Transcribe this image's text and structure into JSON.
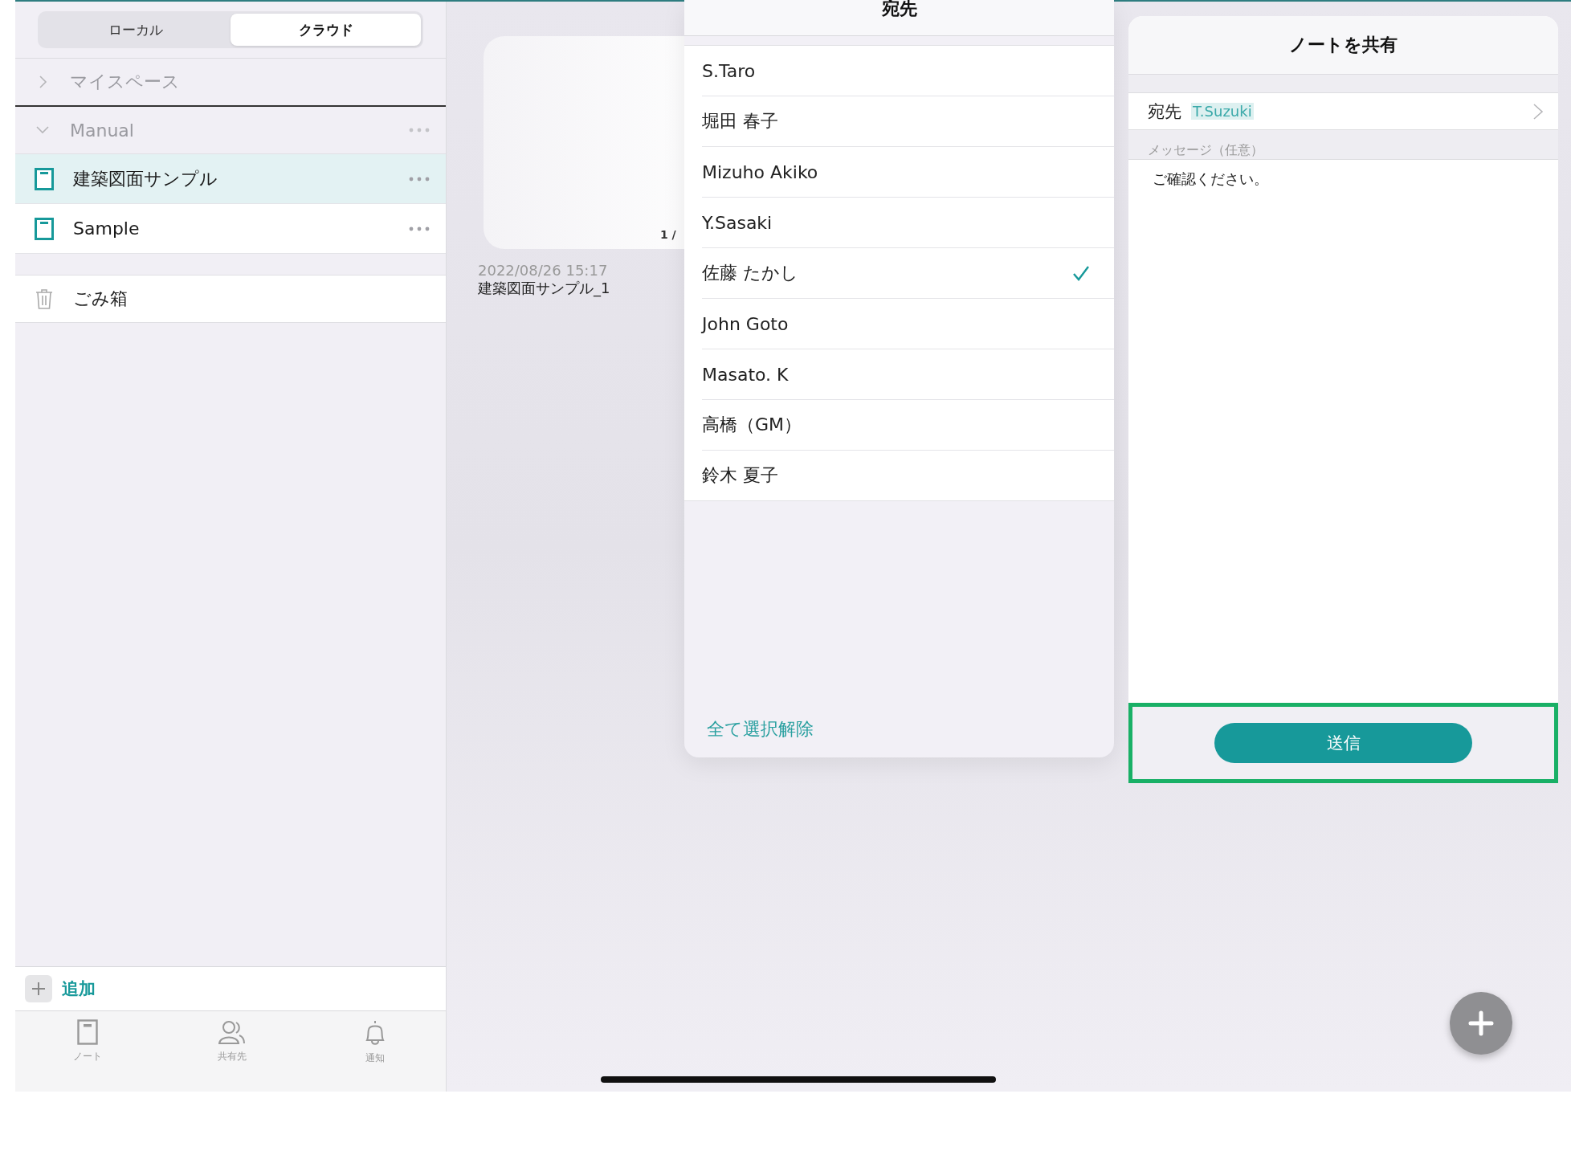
{
  "segmented": [
    {
      "label": "ローカル",
      "selected": false
    },
    {
      "label": "クラウド",
      "selected": true
    }
  ],
  "tree": [
    {
      "label": "マイスペース",
      "expanded": false
    },
    {
      "label": "Manual",
      "expanded": true,
      "children": [
        {
          "label": "建築図面サンプル",
          "selected": true
        },
        {
          "label": "Sample",
          "selected": false
        }
      ]
    }
  ],
  "trash": {
    "label": "ごみ箱"
  },
  "add_button": {
    "label": "追加"
  },
  "tab_bar": [
    {
      "kind": "note",
      "label": "ノート"
    },
    {
      "kind": "people",
      "label": "共有先"
    },
    {
      "kind": "bell",
      "label": "通知"
    }
  ],
  "note_card": {
    "page": "1 /",
    "date": "2022/08/26 15:17",
    "title": "建築図面サンプル_1"
  },
  "recipients": {
    "title": "宛先",
    "items": [
      {
        "name": "S.Taro",
        "selected": false
      },
      {
        "name": "堀田 春子",
        "selected": false
      },
      {
        "name": "Mizuho Akiko",
        "selected": false
      },
      {
        "name": "Y.Sasaki",
        "selected": false
      },
      {
        "name": "佐藤 たかし",
        "selected": true
      },
      {
        "name": "John Goto",
        "selected": false
      },
      {
        "name": "Masato. K",
        "selected": false
      },
      {
        "name": "高橋（GM）",
        "selected": false
      },
      {
        "name": "鈴木 夏子",
        "selected": false
      }
    ],
    "clear_all": "全て選択解除"
  },
  "share": {
    "title": "ノートを共有",
    "to_label": "宛先",
    "to_value": "T.Suzuki",
    "message_label": "メッセージ（任意）",
    "message": "ご確認ください。",
    "send": "送信"
  }
}
